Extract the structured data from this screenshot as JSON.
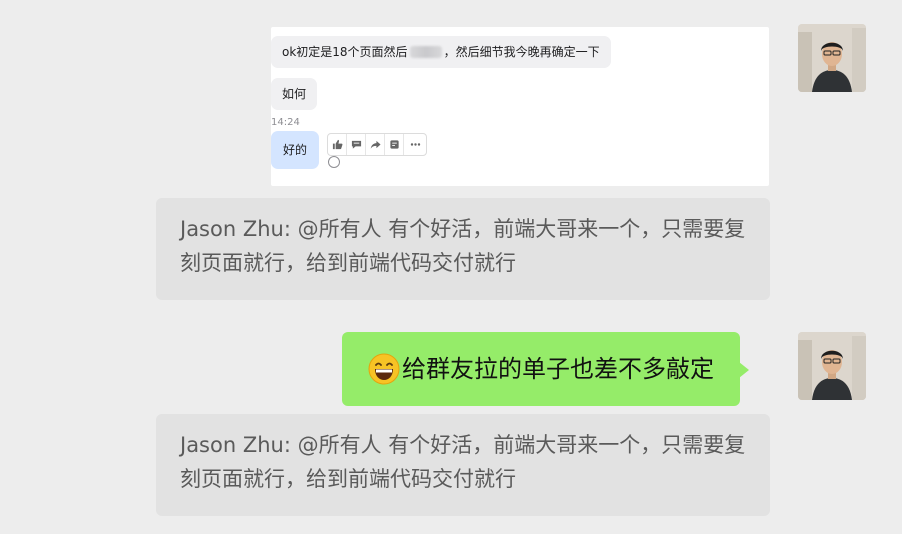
{
  "screenshot": {
    "line1_before": "ok初定是18个页面然后",
    "line1_after": "，然后细节我今晚再确定一下",
    "line2": "如何",
    "time": "14:24",
    "reply": "好的",
    "toolbar_icons": [
      "thumbs-up-icon",
      "comment-icon",
      "forward-icon",
      "bookmark-icon",
      "more-icon"
    ]
  },
  "messages": {
    "grey1": "Jason Zhu: @所有人 有个好活，前端大哥来一个，只需要复刻页面就行，给到前端代码交付就行",
    "green": "给群友拉的单子也差不多敲定",
    "grey2": "Jason Zhu: @所有人 有个好活，前端大哥来一个，只需要复刻页面就行，给到前端代码交付就行"
  },
  "colors": {
    "background": "#ededed",
    "green_bubble": "#95ec69",
    "grey_bubble": "#e2e2e2",
    "screenshot_reply": "#d4e5ff"
  }
}
